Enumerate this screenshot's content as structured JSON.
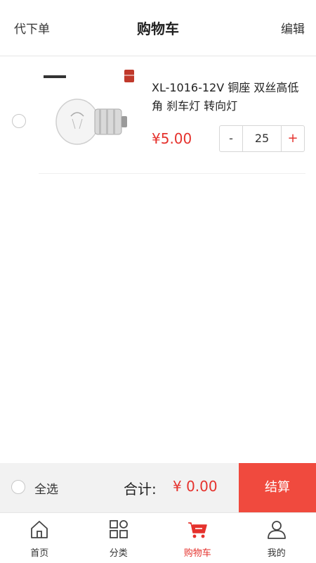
{
  "header": {
    "left_label": "代下单",
    "title": "购物车",
    "right_label": "编辑"
  },
  "cart": {
    "items": [
      {
        "name": "XL-1016-12V 铜座 双丝高低角 刹车灯 转向灯",
        "price": "¥5.00",
        "quantity": "25",
        "minus_label": "-",
        "plus_label": "+"
      }
    ]
  },
  "checkout": {
    "select_all_label": "全选",
    "total_label": "合计:",
    "total_value": "¥ 0.00",
    "pay_label": "结算"
  },
  "tabbar": {
    "tabs": [
      {
        "label": "首页",
        "icon": "home-icon"
      },
      {
        "label": "分类",
        "icon": "grid-icon"
      },
      {
        "label": "购物车",
        "icon": "cart-icon",
        "active": true
      },
      {
        "label": "我的",
        "icon": "user-icon"
      }
    ]
  },
  "colors": {
    "accent": "#e5322d",
    "pay_button": "#f04a3e",
    "checkout_bar": "#f2f2f2"
  }
}
